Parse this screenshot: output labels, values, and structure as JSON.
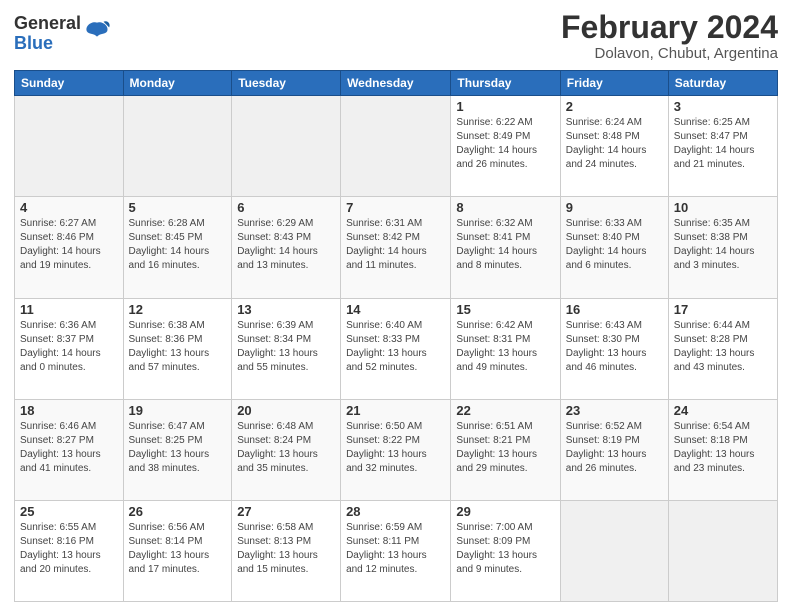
{
  "logo": {
    "general": "General",
    "blue": "Blue"
  },
  "header": {
    "title": "February 2024",
    "subtitle": "Dolavon, Chubut, Argentina"
  },
  "weekdays": [
    "Sunday",
    "Monday",
    "Tuesday",
    "Wednesday",
    "Thursday",
    "Friday",
    "Saturday"
  ],
  "weeks": [
    [
      {
        "day": "",
        "info": ""
      },
      {
        "day": "",
        "info": ""
      },
      {
        "day": "",
        "info": ""
      },
      {
        "day": "",
        "info": ""
      },
      {
        "day": "1",
        "info": "Sunrise: 6:22 AM\nSunset: 8:49 PM\nDaylight: 14 hours\nand 26 minutes."
      },
      {
        "day": "2",
        "info": "Sunrise: 6:24 AM\nSunset: 8:48 PM\nDaylight: 14 hours\nand 24 minutes."
      },
      {
        "day": "3",
        "info": "Sunrise: 6:25 AM\nSunset: 8:47 PM\nDaylight: 14 hours\nand 21 minutes."
      }
    ],
    [
      {
        "day": "4",
        "info": "Sunrise: 6:27 AM\nSunset: 8:46 PM\nDaylight: 14 hours\nand 19 minutes."
      },
      {
        "day": "5",
        "info": "Sunrise: 6:28 AM\nSunset: 8:45 PM\nDaylight: 14 hours\nand 16 minutes."
      },
      {
        "day": "6",
        "info": "Sunrise: 6:29 AM\nSunset: 8:43 PM\nDaylight: 14 hours\nand 13 minutes."
      },
      {
        "day": "7",
        "info": "Sunrise: 6:31 AM\nSunset: 8:42 PM\nDaylight: 14 hours\nand 11 minutes."
      },
      {
        "day": "8",
        "info": "Sunrise: 6:32 AM\nSunset: 8:41 PM\nDaylight: 14 hours\nand 8 minutes."
      },
      {
        "day": "9",
        "info": "Sunrise: 6:33 AM\nSunset: 8:40 PM\nDaylight: 14 hours\nand 6 minutes."
      },
      {
        "day": "10",
        "info": "Sunrise: 6:35 AM\nSunset: 8:38 PM\nDaylight: 14 hours\nand 3 minutes."
      }
    ],
    [
      {
        "day": "11",
        "info": "Sunrise: 6:36 AM\nSunset: 8:37 PM\nDaylight: 14 hours\nand 0 minutes."
      },
      {
        "day": "12",
        "info": "Sunrise: 6:38 AM\nSunset: 8:36 PM\nDaylight: 13 hours\nand 57 minutes."
      },
      {
        "day": "13",
        "info": "Sunrise: 6:39 AM\nSunset: 8:34 PM\nDaylight: 13 hours\nand 55 minutes."
      },
      {
        "day": "14",
        "info": "Sunrise: 6:40 AM\nSunset: 8:33 PM\nDaylight: 13 hours\nand 52 minutes."
      },
      {
        "day": "15",
        "info": "Sunrise: 6:42 AM\nSunset: 8:31 PM\nDaylight: 13 hours\nand 49 minutes."
      },
      {
        "day": "16",
        "info": "Sunrise: 6:43 AM\nSunset: 8:30 PM\nDaylight: 13 hours\nand 46 minutes."
      },
      {
        "day": "17",
        "info": "Sunrise: 6:44 AM\nSunset: 8:28 PM\nDaylight: 13 hours\nand 43 minutes."
      }
    ],
    [
      {
        "day": "18",
        "info": "Sunrise: 6:46 AM\nSunset: 8:27 PM\nDaylight: 13 hours\nand 41 minutes."
      },
      {
        "day": "19",
        "info": "Sunrise: 6:47 AM\nSunset: 8:25 PM\nDaylight: 13 hours\nand 38 minutes."
      },
      {
        "day": "20",
        "info": "Sunrise: 6:48 AM\nSunset: 8:24 PM\nDaylight: 13 hours\nand 35 minutes."
      },
      {
        "day": "21",
        "info": "Sunrise: 6:50 AM\nSunset: 8:22 PM\nDaylight: 13 hours\nand 32 minutes."
      },
      {
        "day": "22",
        "info": "Sunrise: 6:51 AM\nSunset: 8:21 PM\nDaylight: 13 hours\nand 29 minutes."
      },
      {
        "day": "23",
        "info": "Sunrise: 6:52 AM\nSunset: 8:19 PM\nDaylight: 13 hours\nand 26 minutes."
      },
      {
        "day": "24",
        "info": "Sunrise: 6:54 AM\nSunset: 8:18 PM\nDaylight: 13 hours\nand 23 minutes."
      }
    ],
    [
      {
        "day": "25",
        "info": "Sunrise: 6:55 AM\nSunset: 8:16 PM\nDaylight: 13 hours\nand 20 minutes."
      },
      {
        "day": "26",
        "info": "Sunrise: 6:56 AM\nSunset: 8:14 PM\nDaylight: 13 hours\nand 17 minutes."
      },
      {
        "day": "27",
        "info": "Sunrise: 6:58 AM\nSunset: 8:13 PM\nDaylight: 13 hours\nand 15 minutes."
      },
      {
        "day": "28",
        "info": "Sunrise: 6:59 AM\nSunset: 8:11 PM\nDaylight: 13 hours\nand 12 minutes."
      },
      {
        "day": "29",
        "info": "Sunrise: 7:00 AM\nSunset: 8:09 PM\nDaylight: 13 hours\nand 9 minutes."
      },
      {
        "day": "",
        "info": ""
      },
      {
        "day": "",
        "info": ""
      }
    ]
  ]
}
